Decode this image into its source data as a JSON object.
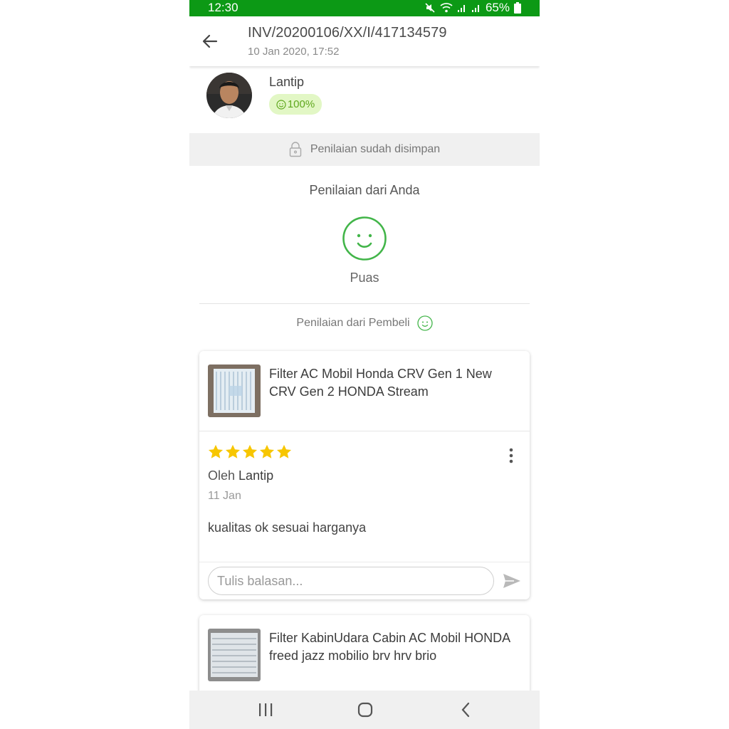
{
  "status_bar": {
    "time": "12:30",
    "battery": "65%",
    "icons": [
      "mute-icon",
      "wifi-icon",
      "signal-icon",
      "signal-icon",
      "battery-icon"
    ]
  },
  "header": {
    "invoice": "INV/20200106/XX/I/417134579",
    "date": "10 Jan 2020, 17:52"
  },
  "seller": {
    "name": "Lantip",
    "score": "100%"
  },
  "notice": {
    "text": "Penilaian sudah disimpan"
  },
  "your_rating": {
    "title": "Penilaian dari Anda",
    "label": "Puas"
  },
  "buyer_rating": {
    "title": "Penilaian dari Pembeli"
  },
  "reviews": [
    {
      "product": "Filter AC Mobil Honda CRV Gen 1 New CRV Gen 2 HONDA Stream",
      "stars": 5,
      "by_prefix": "Oleh",
      "author": "Lantip",
      "date": "11 Jan",
      "text": "kualitas ok sesuai harganya",
      "reply_placeholder": "Tulis balasan..."
    },
    {
      "product": "Filter KabinUdara Cabin AC Mobil HONDA freed jazz mobilio brv hrv brio"
    }
  ],
  "colors": {
    "status_bar": "#0c9915",
    "accent_green": "#42b549",
    "star": "#f7c600",
    "badge_bg": "#e2f7c5"
  }
}
